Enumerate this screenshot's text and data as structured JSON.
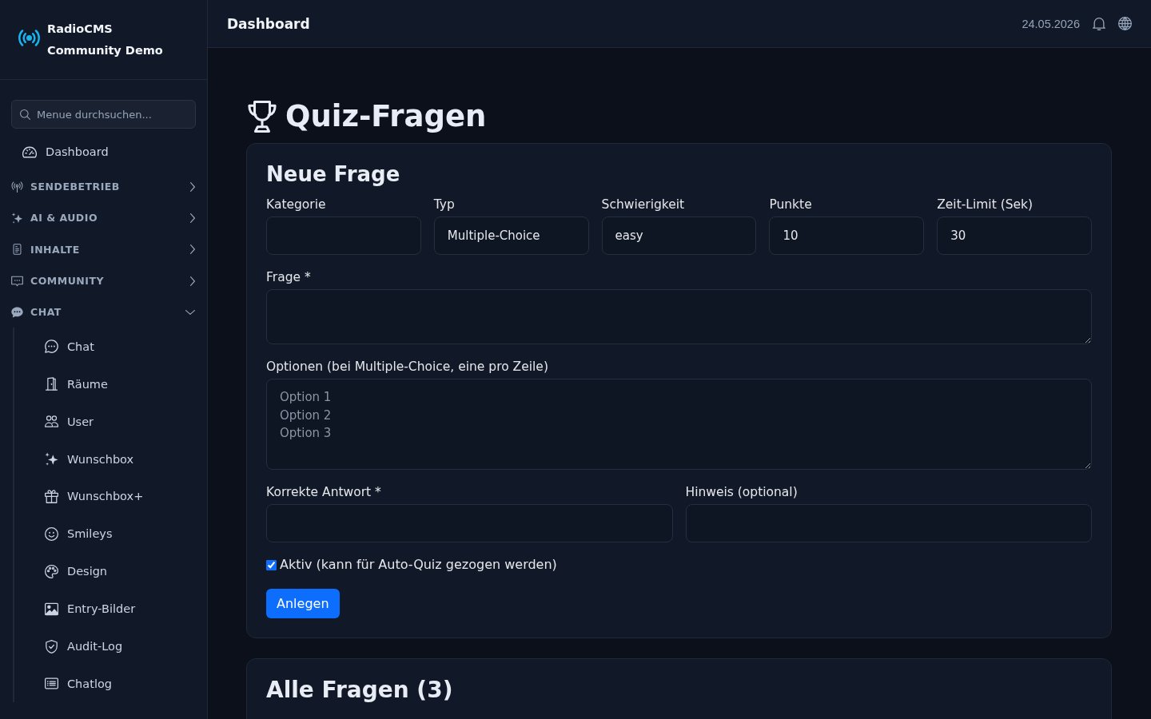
{
  "sidebar": {
    "brand": "RadioCMS Community Demo",
    "search": {
      "placeholder": "Menue durchsuchen..."
    },
    "nav": [
      {
        "kind": "link",
        "label": "Dashboard"
      },
      {
        "kind": "section",
        "label": "SENDEBETRIEB",
        "expanded": false
      },
      {
        "kind": "section",
        "label": "AI & AUDIO",
        "expanded": false
      },
      {
        "kind": "section",
        "label": "INHALTE",
        "expanded": false
      },
      {
        "kind": "section",
        "label": "COMMUNITY",
        "expanded": false
      },
      {
        "kind": "section",
        "label": "CHAT",
        "expanded": true,
        "children": [
          {
            "label": "Chat"
          },
          {
            "label": "Räume"
          },
          {
            "label": "User"
          },
          {
            "label": "Wunschbox"
          },
          {
            "label": "Wunschbox+"
          },
          {
            "label": "Smileys"
          },
          {
            "label": "Design"
          },
          {
            "label": "Entry-Bilder"
          },
          {
            "label": "Audit-Log"
          },
          {
            "label": "Chatlog"
          }
        ]
      }
    ]
  },
  "header": {
    "title": "Dashboard",
    "date": "24.05.2026"
  },
  "page": {
    "title": "Quiz-Fragen"
  },
  "new_question": {
    "title": "Neue Frage",
    "rows": [
      {
        "fields": [
          {
            "kind": "input",
            "label": "Kategorie"
          },
          {
            "kind": "input",
            "label": "Typ",
            "value": "Multiple-Choice"
          },
          {
            "kind": "input",
            "label": "Schwierigkeit",
            "value": "easy"
          },
          {
            "kind": "input",
            "label": "Punkte",
            "value": "10"
          },
          {
            "kind": "input",
            "label": "Zeit-Limit (Sek)",
            "value": "30"
          }
        ]
      },
      {
        "fields": [
          {
            "kind": "textarea",
            "label": "Frage *"
          }
        ]
      },
      {
        "fields": [
          {
            "kind": "textarea",
            "label": "Optionen (bei Multiple-Choice, eine pro Zeile)",
            "placeholder": "Option 1\nOption 2\nOption 3"
          }
        ]
      },
      {
        "fields": [
          {
            "kind": "input",
            "label": "Korrekte Antwort *"
          },
          {
            "kind": "input",
            "label": "Hinweis (optional)"
          }
        ]
      }
    ],
    "active": {
      "label": "Aktiv (kann für Auto-Quiz gezogen werden)",
      "checked": true
    },
    "submit": "Anlegen"
  },
  "all_questions": {
    "title": "Alle Fragen (3)"
  }
}
